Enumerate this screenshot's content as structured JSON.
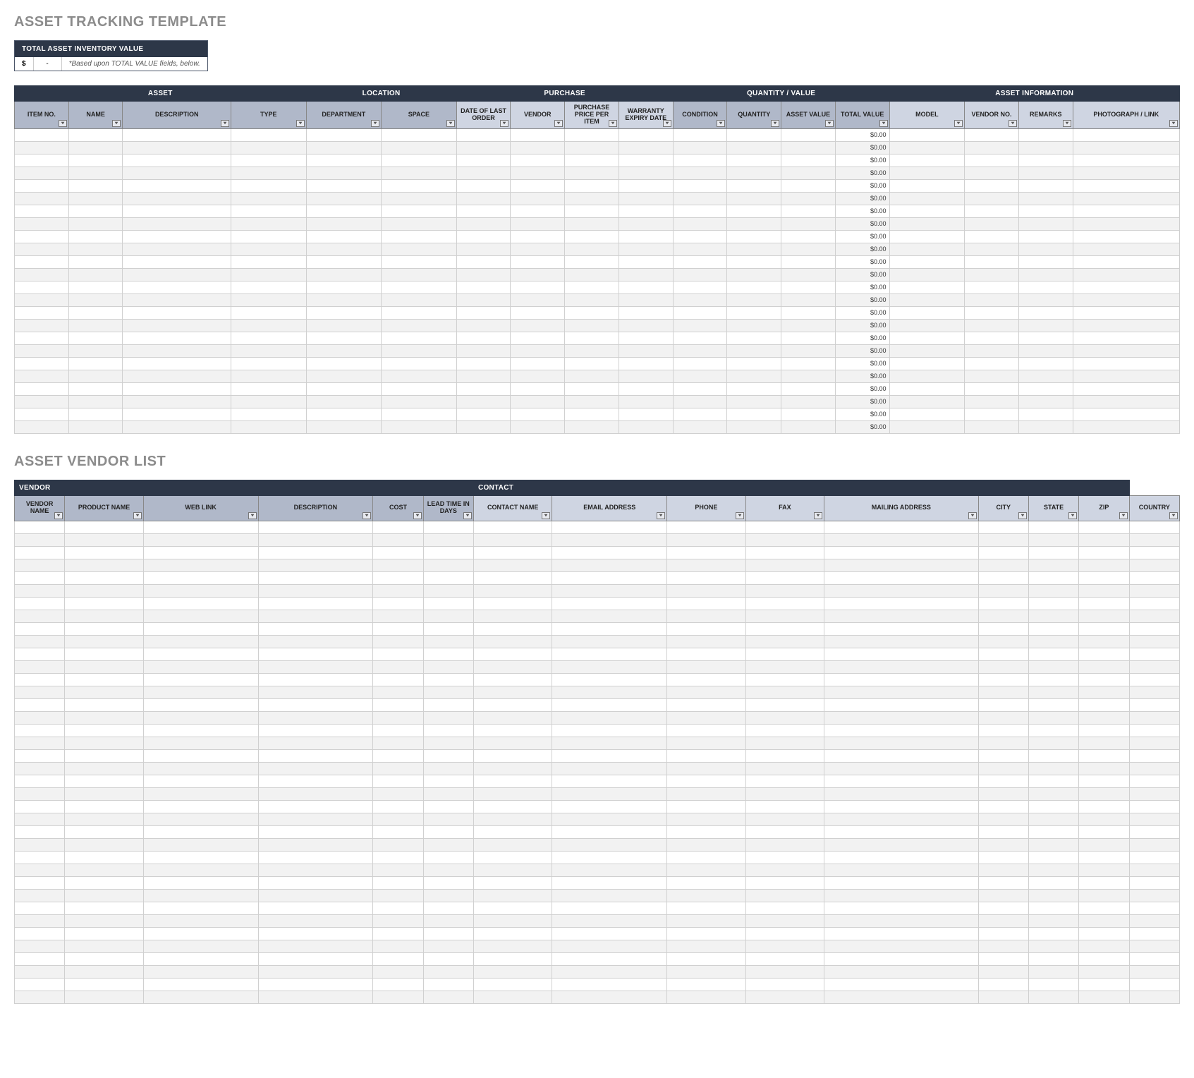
{
  "titles": {
    "asset_tracking": "ASSET TRACKING TEMPLATE",
    "vendor_list": "ASSET VENDOR LIST"
  },
  "summary": {
    "header": "TOTAL ASSET INVENTORY VALUE",
    "currency": "$",
    "value": "-",
    "note": "*Based upon TOTAL VALUE fields, below."
  },
  "asset_table": {
    "groups": [
      {
        "label": "ASSET",
        "span": 4
      },
      {
        "label": "LOCATION",
        "span": 2
      },
      {
        "label": "PURCHASE",
        "span": 4
      },
      {
        "label": "QUANTITY / VALUE",
        "span": 4
      },
      {
        "label": "ASSET INFORMATION",
        "span": 4
      }
    ],
    "columns": [
      "ITEM NO.",
      "NAME",
      "DESCRIPTION",
      "TYPE",
      "DEPARTMENT",
      "SPACE",
      "DATE OF LAST ORDER",
      "VENDOR",
      "PURCHASE PRICE PER ITEM",
      "WARRANTY EXPIRY DATE",
      "CONDITION",
      "QUANTITY",
      "ASSET VALUE",
      "TOTAL VALUE",
      "MODEL",
      "VENDOR NO.",
      "REMARKS",
      "PHOTOGRAPH / LINK"
    ],
    "total_value_cell": "$0.00",
    "row_count": 24,
    "total_value_col_index": 13
  },
  "vendor_table": {
    "groups": [
      {
        "label": "VENDOR",
        "span": 6
      },
      {
        "label": "CONTACT",
        "span": 8
      }
    ],
    "columns": [
      "VENDOR NAME",
      "PRODUCT NAME",
      "WEB LINK",
      "DESCRIPTION",
      "COST",
      "LEAD TIME IN DAYS",
      "CONTACT NAME",
      "EMAIL ADDRESS",
      "PHONE",
      "FAX",
      "MAILING ADDRESS",
      "CITY",
      "STATE",
      "ZIP",
      "COUNTRY"
    ],
    "row_count": 38
  }
}
